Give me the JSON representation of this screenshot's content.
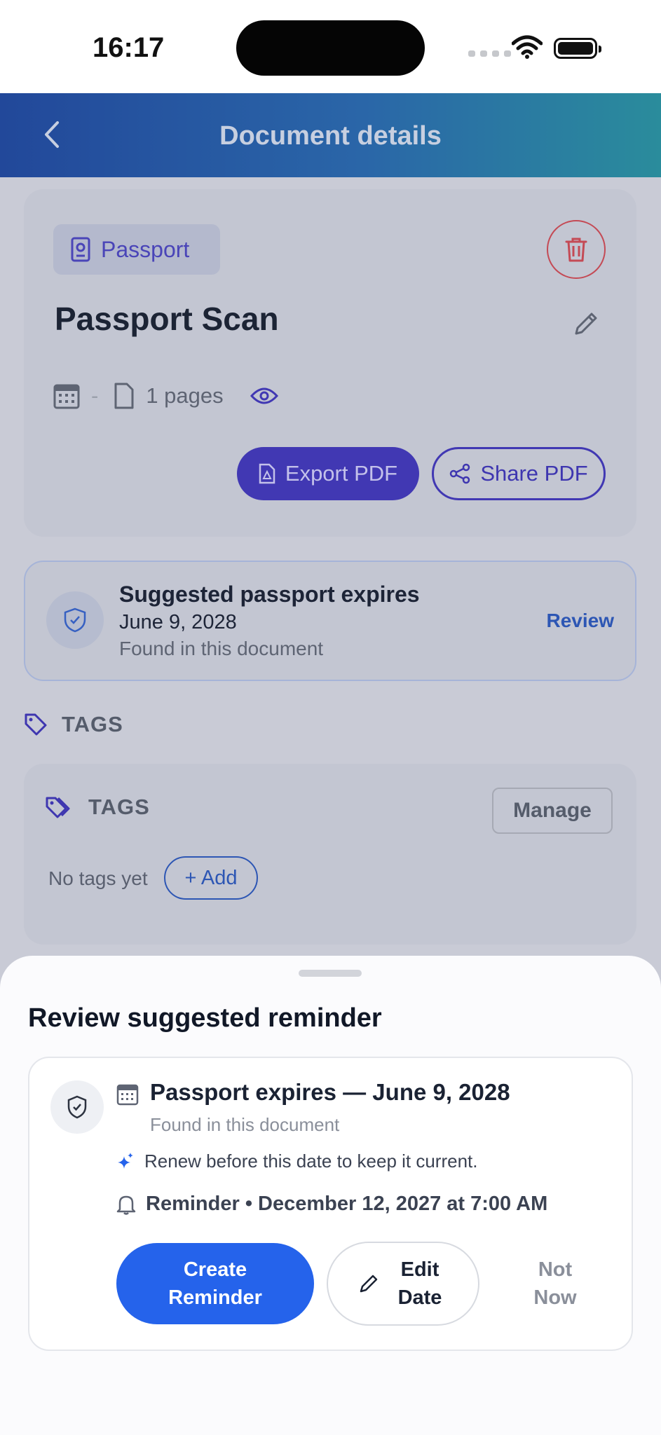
{
  "status_bar": {
    "time": "16:17"
  },
  "header": {
    "title": "Document details"
  },
  "document": {
    "category": "Passport",
    "title": "Passport Scan",
    "date": "-",
    "pages": "1 pages",
    "export_label": "Export PDF",
    "share_label": "Share PDF"
  },
  "suggestion": {
    "title": "Suggested passport expires",
    "date": "June 9, 2028",
    "source": "Found in this document",
    "action": "Review"
  },
  "tags_section": {
    "heading": "TAGS",
    "card_heading": "TAGS",
    "manage_label": "Manage",
    "empty_text": "No tags yet",
    "add_label": "+ Add"
  },
  "sheet": {
    "title": "Review suggested reminder",
    "reminder_title": "Passport expires — June 9, 2028",
    "source": "Found in this document",
    "hint": "Renew before this date to keep it current.",
    "reminder": "Reminder • December 12, 2027 at 7:00 AM",
    "create_label": "Create Reminder",
    "edit_label": "Edit Date",
    "not_now_label": "Not Now"
  },
  "colors": {
    "header_gradient_start": "#22489a",
    "header_gradient_end": "#2a8c9c",
    "primary": "#2563eb",
    "export_button": "#4138b3",
    "delete": "#c44a55"
  }
}
